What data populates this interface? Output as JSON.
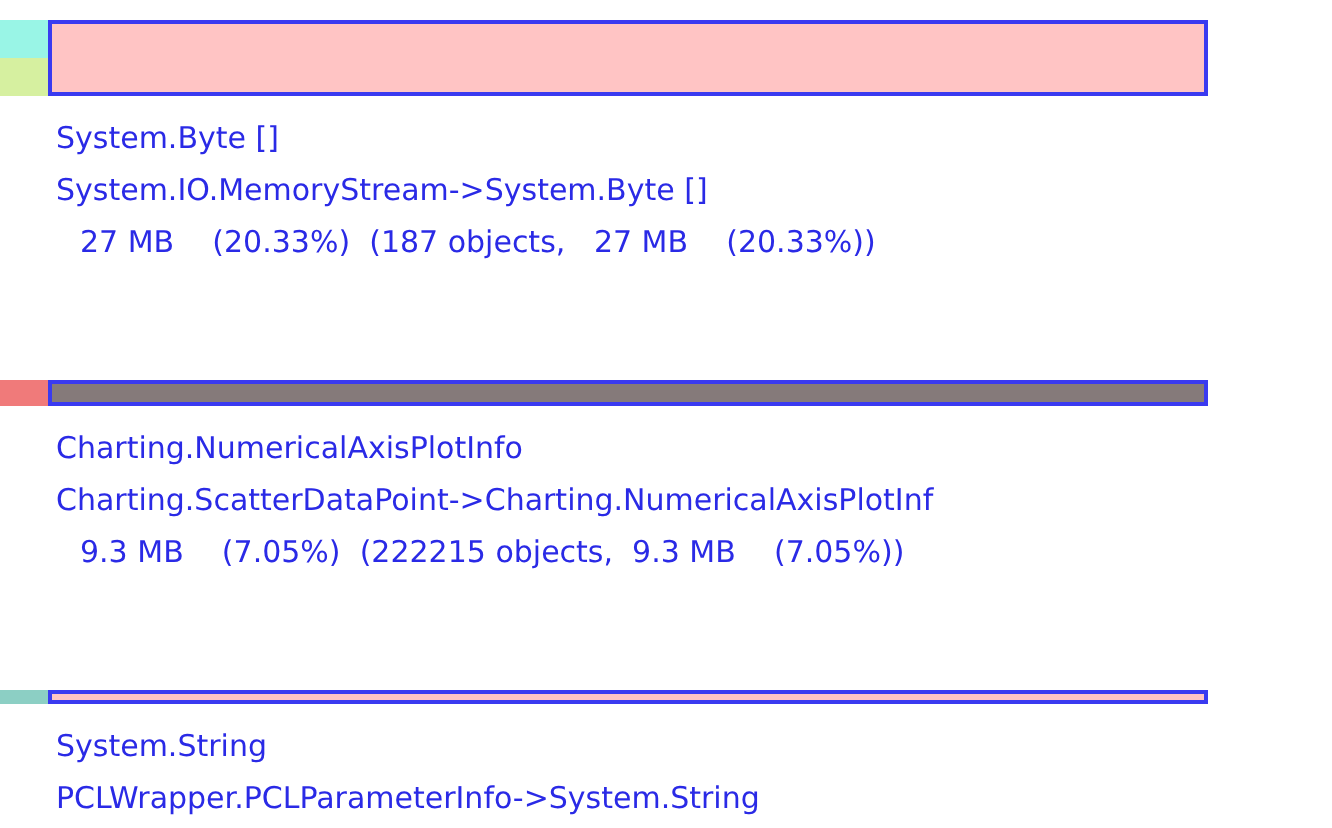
{
  "entries": [
    {
      "color": "#ffc4c4",
      "name": "System.Byte []",
      "path": "System.IO.MemoryStream->System.Byte []",
      "stats": "27 MB    (20.33%)  (187 objects,   27 MB    (20.33%))"
    },
    {
      "color": "#857a7a",
      "name": "Charting.NumericalAxisPlotInfo",
      "path": "Charting.ScatterDataPoint->Charting.NumericalAxisPlotInf",
      "stats": "9.3 MB    (7.05%)  (222215 objects,  9.3 MB    (7.05%))"
    },
    {
      "color": "#ffc4c4",
      "name": "System.String",
      "path": "PCLWrapper.PCLParameterInfo->System.String"
    }
  ]
}
